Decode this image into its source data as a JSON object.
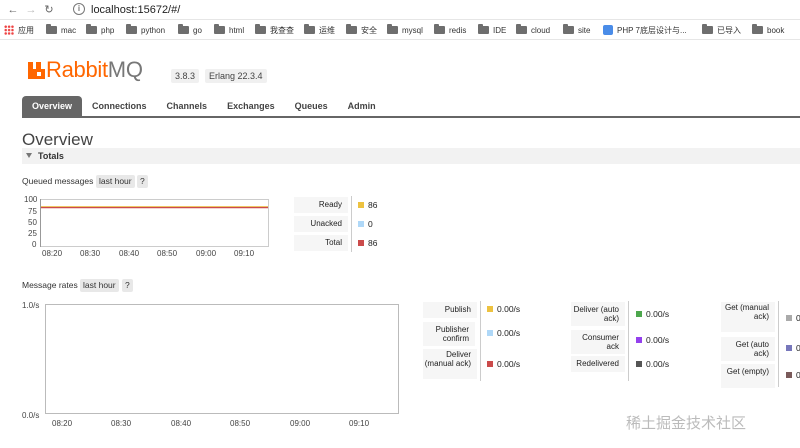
{
  "browser": {
    "url": "localhost:15672/#/",
    "bookmarks": [
      "应用",
      "mac",
      "php",
      "python",
      "go",
      "html",
      "我查查",
      "运维",
      "安全",
      "mysql",
      "redis",
      "IDE",
      "cloud",
      "site",
      "PHP 7底层设计与...",
      "已导入",
      "book"
    ]
  },
  "header": {
    "brand_rabbit": "Rabbit",
    "brand_mq": "MQ",
    "version": "3.8.3",
    "erlang": "Erlang 22.3.4"
  },
  "tabs": [
    "Overview",
    "Connections",
    "Channels",
    "Exchanges",
    "Queues",
    "Admin"
  ],
  "page_title": "Overview",
  "totals": {
    "label": "Totals"
  },
  "queued": {
    "label": "Queued messages",
    "range": "last hour",
    "help": "?",
    "y_ticks": [
      "100",
      "75",
      "50",
      "25",
      "0"
    ],
    "x_ticks": [
      "08:20",
      "08:30",
      "08:40",
      "08:50",
      "09:00",
      "09:10"
    ],
    "legend": [
      {
        "label": "Ready",
        "value": "86",
        "color": "#edc240"
      },
      {
        "label": "Unacked",
        "value": "0",
        "color": "#afd8f8"
      },
      {
        "label": "Total",
        "value": "86",
        "color": "#cb4b4b"
      }
    ]
  },
  "rates": {
    "label": "Message rates",
    "range": "last hour",
    "help": "?",
    "y_ticks": [
      "1.0/s",
      "0.0/s"
    ],
    "x_ticks": [
      "08:20",
      "08:30",
      "08:40",
      "08:50",
      "09:00",
      "09:10"
    ],
    "legend": [
      {
        "label": "Publish",
        "value": "0.00/s",
        "color": "#edc240"
      },
      {
        "label": "Publisher confirm",
        "value": "0.00/s",
        "color": "#afd8f8"
      },
      {
        "label": "Deliver (manual ack)",
        "value": "0.00/s",
        "color": "#cb4b4b"
      },
      {
        "label": "Deliver (auto ack)",
        "value": "0.00/s",
        "color": "#4da74d"
      },
      {
        "label": "Consumer ack",
        "value": "0.00/s",
        "color": "#9440ed"
      },
      {
        "label": "Redelivered",
        "value": "0.00/s",
        "color": "#555555"
      },
      {
        "label": "Get (manual ack)",
        "value": "0",
        "color": "#aaaaaa"
      },
      {
        "label": "Get (auto ack)",
        "value": "0",
        "color": "#7777bb"
      },
      {
        "label": "Get (empty)",
        "value": "0",
        "color": "#7a5a5a"
      }
    ]
  },
  "watermark": "稀土掘金技术社区"
}
